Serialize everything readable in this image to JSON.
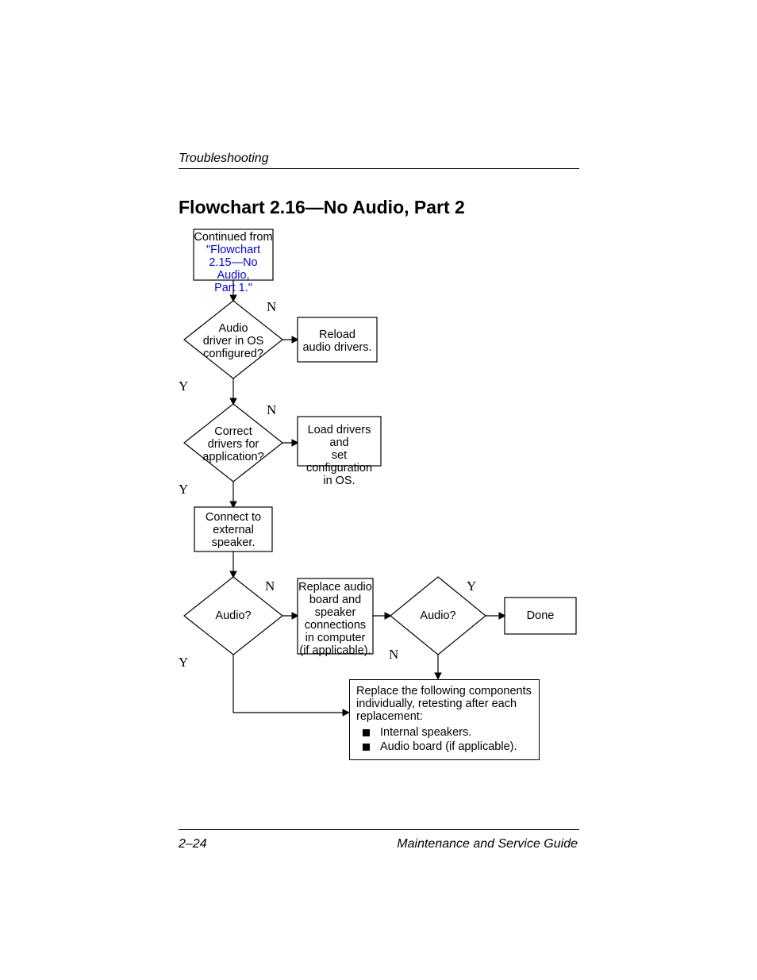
{
  "header": "Troubleshooting",
  "title": "Flowchart 2.16—No Audio, Part 2",
  "footer_left": "2–24",
  "footer_right": "Maintenance and Service Guide",
  "nodes": {
    "start_l1": "Continued from",
    "start_l2": "\"Flowchart",
    "start_l3": "2.15—No Audio,",
    "start_l4": "Part 1.\"",
    "d1_l1": "Audio",
    "d1_l2": "driver in OS",
    "d1_l3": "configured?",
    "p1_l1": "Reload",
    "p1_l2": "audio drivers.",
    "d2_l1": "Correct",
    "d2_l2": "drivers for",
    "d2_l3": "application?",
    "p2_l1": "Load drivers and",
    "p2_l2": "set configuration",
    "p2_l3": "in OS.",
    "p3_l1": "Connect to",
    "p3_l2": "external",
    "p3_l3": "speaker.",
    "d3": "Audio?",
    "p4_l1": "Replace audio",
    "p4_l2": "board and",
    "p4_l3": "speaker",
    "p4_l4": "connections",
    "p4_l5": "in computer",
    "p4_l6": "(if applicable).",
    "d4": "Audio?",
    "done": "Done",
    "replace_heading_l1": "Replace the following components",
    "replace_heading_l2": "individually, retesting after each",
    "replace_heading_l3": "replacement:",
    "replace_item1": "Internal speakers.",
    "replace_item2": "Audio board (if applicable)."
  },
  "edge_labels": {
    "N": "N",
    "Y": "Y"
  }
}
